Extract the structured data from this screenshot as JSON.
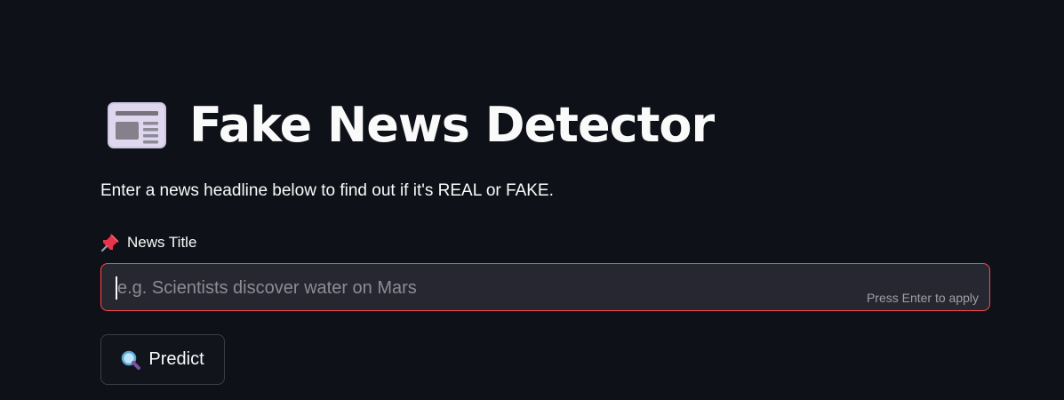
{
  "header": {
    "icon": "newspaper-icon",
    "title": "Fake News Detector"
  },
  "subtitle": "Enter a news headline below to find out if it's REAL or FAKE.",
  "news_field": {
    "label_icon": "pushpin-icon",
    "label": "News Title",
    "value": "",
    "placeholder": "e.g. Scientists discover water on Mars",
    "hint": "Press Enter to apply"
  },
  "predict_button": {
    "icon": "magnifying-glass-icon",
    "label": "Predict"
  },
  "colors": {
    "background": "#0e1117",
    "input_background": "#262730",
    "input_border_focus": "#ff4b4b",
    "text": "#fafafa"
  }
}
